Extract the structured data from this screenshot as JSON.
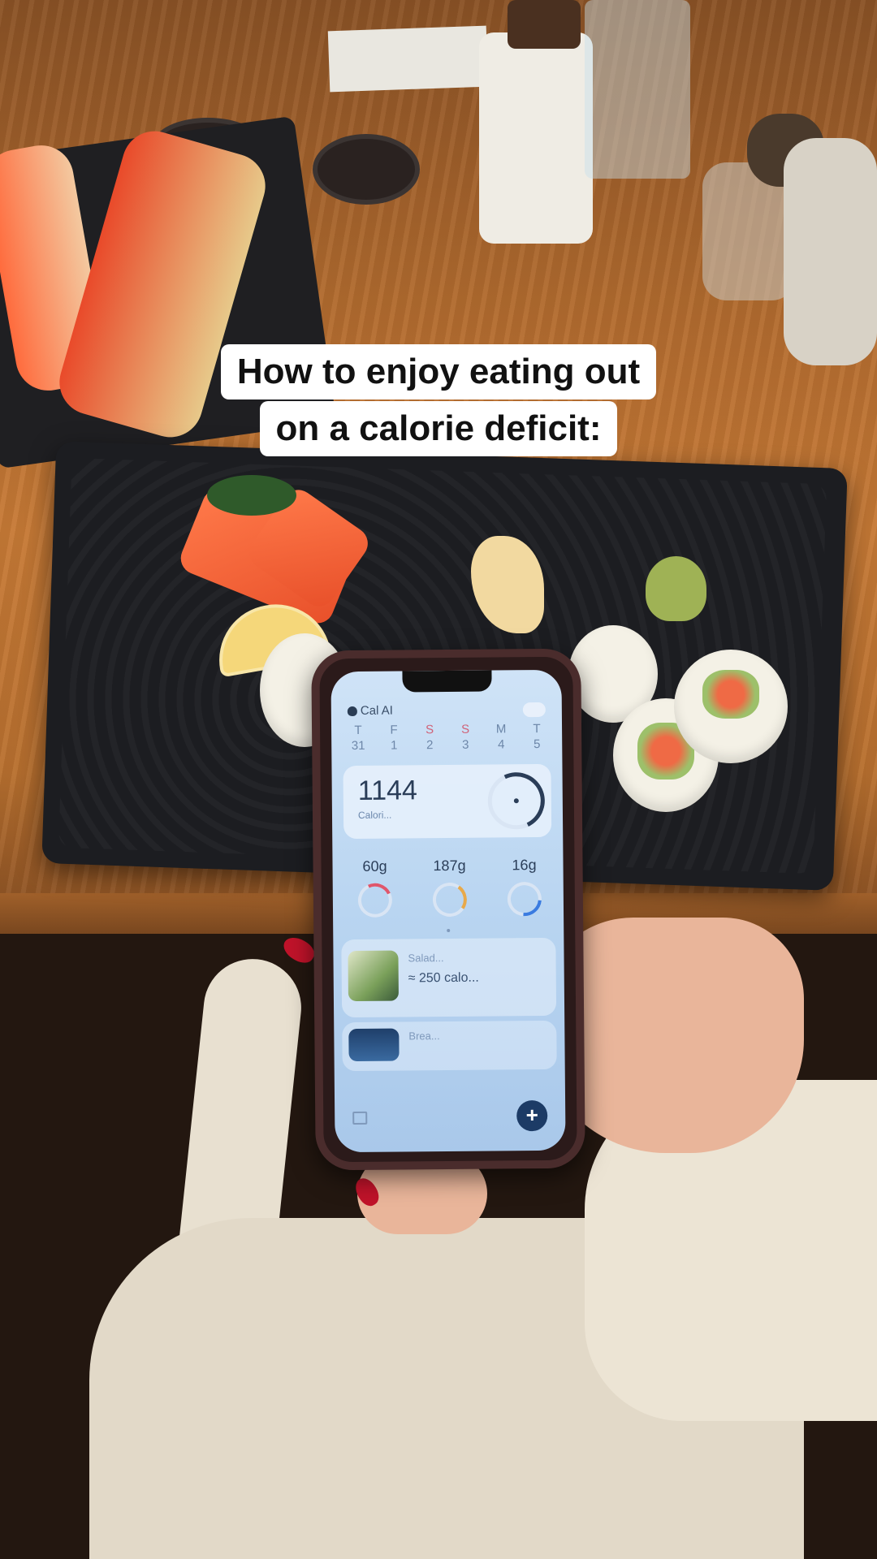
{
  "caption": {
    "line1": "How to enjoy eating out",
    "line2": "on a calorie deficit:"
  },
  "app": {
    "name": "Cal AI",
    "days": [
      {
        "letter": "T",
        "num": "31",
        "weekend": false
      },
      {
        "letter": "F",
        "num": "1",
        "weekend": false
      },
      {
        "letter": "S",
        "num": "2",
        "weekend": true
      },
      {
        "letter": "S",
        "num": "3",
        "weekend": true
      },
      {
        "letter": "M",
        "num": "4",
        "weekend": false
      },
      {
        "letter": "T",
        "num": "5",
        "weekend": false
      }
    ],
    "calories": {
      "value": "1144",
      "label": "Calori..."
    },
    "macros": [
      {
        "value": "60g",
        "color": "#e0566b"
      },
      {
        "value": "187g",
        "color": "#e8a94a"
      },
      {
        "value": "16g",
        "color": "#3a7be0"
      }
    ],
    "food_items": [
      {
        "name": "Salad...",
        "calories": "≈ 250 calo..."
      },
      {
        "name": "Brea..."
      }
    ],
    "fab_label": "+"
  }
}
